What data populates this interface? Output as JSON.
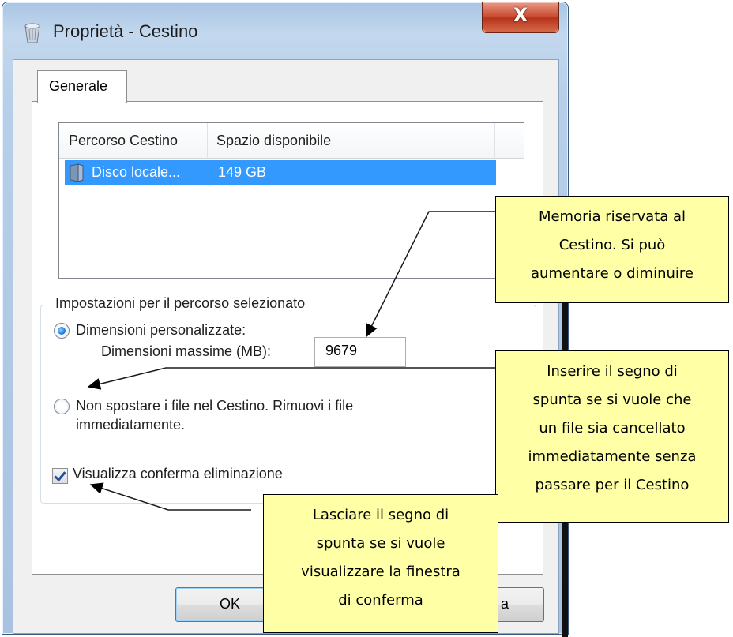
{
  "window": {
    "title": "Proprietà - Cestino",
    "close_glyph": "X"
  },
  "tabs": [
    {
      "label": "Generale",
      "selected": true
    }
  ],
  "list": {
    "columns": [
      "Percorso Cestino",
      "Spazio disponibile"
    ],
    "rows": [
      {
        "location": "Disco locale...",
        "space": "149 GB",
        "selected": true,
        "icon": "drive-icon"
      }
    ]
  },
  "settings": {
    "group_label": "Impostazioni per il percorso selezionato",
    "custom_size_label": "Dimensioni personalizzate:",
    "max_size_label": "Dimensioni massime (MB):",
    "max_size_value": "9679",
    "custom_size_selected": true,
    "no_recycle_line1": "Non spostare i file nel Cestino. Rimuovi i file",
    "no_recycle_line2": "immediatamente.",
    "no_recycle_selected": false,
    "confirm_delete_label": "Visualizza conferma eliminazione",
    "confirm_delete_checked": true
  },
  "buttons": {
    "ok": "OK",
    "cancel_fragment": "a"
  },
  "callouts": {
    "memory": [
      "Memoria riservata al",
      "Cestino. Si può",
      "aumentare o diminuire"
    ],
    "immediate": [
      "Inserire il segno di",
      "spunta se si vuole che",
      "un file sia cancellato",
      "immediatamente  senza",
      "passare per il Cestino"
    ],
    "confirm": [
      "Lasciare il segno di",
      "spunta se si vuole",
      "visualizzare la finestra",
      "di conferma"
    ],
    "background_color": "#ffffa5"
  },
  "colors": {
    "selection": "#3399ff",
    "close_button": "#c8462c",
    "frame": "#b7cfe9"
  }
}
